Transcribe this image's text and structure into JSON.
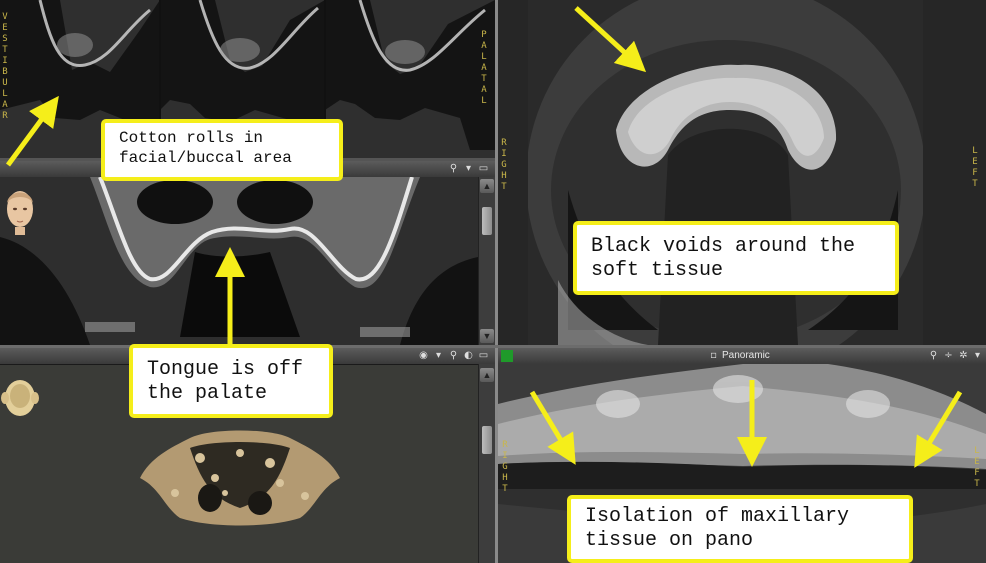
{
  "panes": {
    "top_left": {
      "left_label": "V\nE\nS\nT\nI\nB\nU\nL\nA\nR",
      "right_label": "P\nA\nL\nA\nT\nA\nL"
    },
    "axial": {
      "left_label": "R\nI\nG\nH\nT",
      "right_label": "L\nE\nF\nT"
    },
    "panoramic": {
      "title": "Panoramic",
      "left_label": "R\nI\nG\nH\nT",
      "right_label": "L\nE\nF\nT"
    }
  },
  "callouts": {
    "cotton": "Cotton rolls in\nfacial/buccal area",
    "voids": "Black voids around the\nsoft tissue",
    "tongue": "Tongue is off\nthe palate",
    "isolation": "Isolation of maxillary\ntissue on pano"
  },
  "colors": {
    "callout_border": "#f5ee1a",
    "arrow": "#f5ee1a",
    "orientation_label": "#c9b64a"
  }
}
